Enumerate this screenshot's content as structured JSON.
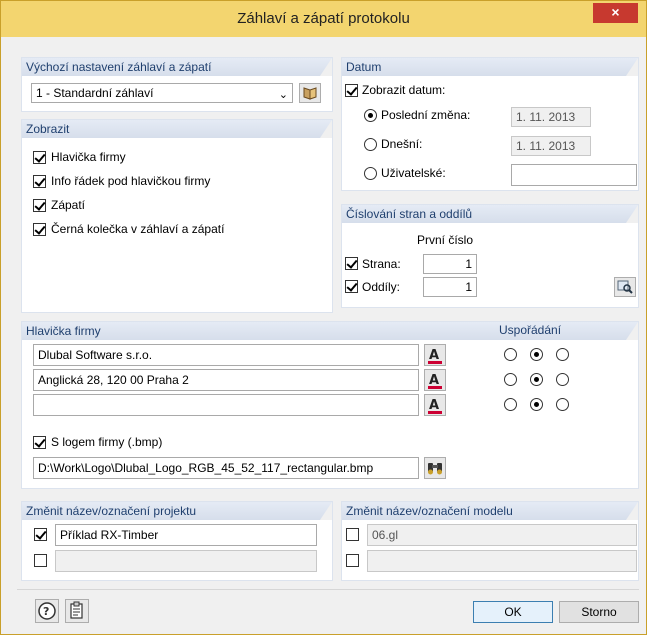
{
  "window": {
    "title": "Záhlaví a zápatí protokolu",
    "close_glyph": "×"
  },
  "defaults": {
    "header": "Výchozí nastavení záhlaví a zápatí",
    "selected": "1 - Standardní záhlaví"
  },
  "display": {
    "header": "Zobrazit",
    "items": [
      {
        "label": "Hlavička firmy",
        "checked": true
      },
      {
        "label": "Info řádek pod hlavičkou firmy",
        "checked": true
      },
      {
        "label": "Zápatí",
        "checked": true
      },
      {
        "label": "Černá kolečka v záhlaví a zápatí",
        "checked": true
      }
    ]
  },
  "date": {
    "header": "Datum",
    "show_label": "Zobrazit datum:",
    "options": [
      {
        "label": "Poslední změna:",
        "value": "1. 11. 2013",
        "selected": true
      },
      {
        "label": "Dnešní:",
        "value": "1. 11. 2013",
        "selected": false
      },
      {
        "label": "Uživatelské:",
        "value": "",
        "selected": false
      }
    ]
  },
  "numbering": {
    "header": "Číslování stran a oddílů",
    "first_label": "První číslo",
    "page_label": "Strana:",
    "page_value": "1",
    "section_label": "Oddíly:",
    "section_value": "1"
  },
  "company": {
    "header": "Hlavička firmy",
    "arrange_header": "Uspořádání",
    "lines": [
      "Dlubal Software s.r.o.",
      "Anglická 28, 120 00 Praha 2",
      ""
    ],
    "logo_label": "S logem firmy (.bmp)",
    "logo_path": "D:\\Work\\Logo\\Dlubal_Logo_RGB_45_52_117_rectangular.bmp"
  },
  "project": {
    "header": "Změnit název/označení projektu",
    "line1": "Příklad RX-Timber",
    "line2": ""
  },
  "model": {
    "header": "Změnit název/označení modelu",
    "line1": "06.gl",
    "line2": ""
  },
  "footer": {
    "ok": "OK",
    "cancel": "Storno"
  },
  "colors": {
    "title_bar": "#f3d56f",
    "close": "#c7392f",
    "group_head_text": "#1f3f6e"
  }
}
